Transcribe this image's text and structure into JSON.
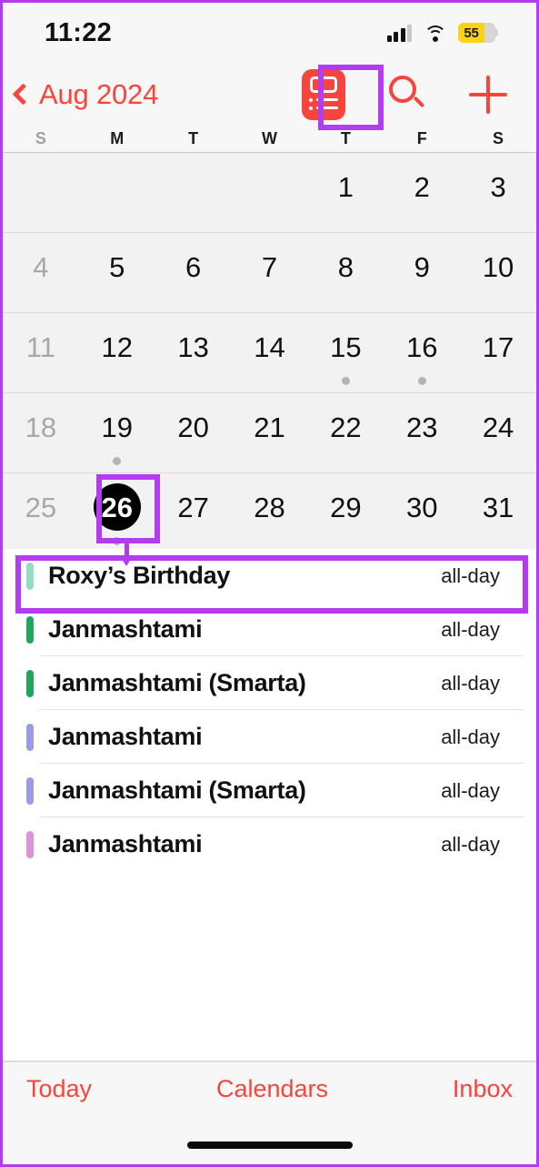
{
  "status_bar": {
    "time": "11:22",
    "battery_percent": "55",
    "signal_icon": "cellular-signal-icon",
    "wifi_icon": "wifi-icon",
    "battery_icon": "battery-icon",
    "battery_color": "#fcd216"
  },
  "nav_bar": {
    "back_label": "Aug 2024",
    "back_icon": "chevron-left-icon",
    "list_view_icon": "list-view-toggle-icon",
    "search_icon": "search-icon",
    "add_icon": "plus-icon",
    "accent_color": "#f5453c"
  },
  "weekdays": [
    {
      "label": "S",
      "dim": true
    },
    {
      "label": "M",
      "dim": false
    },
    {
      "label": "T",
      "dim": false
    },
    {
      "label": "W",
      "dim": false
    },
    {
      "label": "T",
      "dim": false
    },
    {
      "label": "F",
      "dim": false
    },
    {
      "label": "S",
      "dim": false
    }
  ],
  "calendar": {
    "month_label": "Aug 2024",
    "selected_day": "26",
    "rows": [
      [
        {
          "label": "",
          "dim": false,
          "selected": false,
          "dot": false
        },
        {
          "label": "",
          "dim": false,
          "selected": false,
          "dot": false
        },
        {
          "label": "",
          "dim": false,
          "selected": false,
          "dot": false
        },
        {
          "label": "",
          "dim": false,
          "selected": false,
          "dot": false
        },
        {
          "label": "1",
          "dim": false,
          "selected": false,
          "dot": false
        },
        {
          "label": "2",
          "dim": false,
          "selected": false,
          "dot": false
        },
        {
          "label": "3",
          "dim": false,
          "selected": false,
          "dot": false
        }
      ],
      [
        {
          "label": "4",
          "dim": true,
          "selected": false,
          "dot": false
        },
        {
          "label": "5",
          "dim": false,
          "selected": false,
          "dot": false
        },
        {
          "label": "6",
          "dim": false,
          "selected": false,
          "dot": false
        },
        {
          "label": "7",
          "dim": false,
          "selected": false,
          "dot": false
        },
        {
          "label": "8",
          "dim": false,
          "selected": false,
          "dot": false
        },
        {
          "label": "9",
          "dim": false,
          "selected": false,
          "dot": false
        },
        {
          "label": "10",
          "dim": false,
          "selected": false,
          "dot": false
        }
      ],
      [
        {
          "label": "11",
          "dim": true,
          "selected": false,
          "dot": false
        },
        {
          "label": "12",
          "dim": false,
          "selected": false,
          "dot": false
        },
        {
          "label": "13",
          "dim": false,
          "selected": false,
          "dot": false
        },
        {
          "label": "14",
          "dim": false,
          "selected": false,
          "dot": false
        },
        {
          "label": "15",
          "dim": false,
          "selected": false,
          "dot": true
        },
        {
          "label": "16",
          "dim": false,
          "selected": false,
          "dot": true
        },
        {
          "label": "17",
          "dim": false,
          "selected": false,
          "dot": false
        }
      ],
      [
        {
          "label": "18",
          "dim": true,
          "selected": false,
          "dot": false
        },
        {
          "label": "19",
          "dim": false,
          "selected": false,
          "dot": true
        },
        {
          "label": "20",
          "dim": false,
          "selected": false,
          "dot": false
        },
        {
          "label": "21",
          "dim": false,
          "selected": false,
          "dot": false
        },
        {
          "label": "22",
          "dim": false,
          "selected": false,
          "dot": false
        },
        {
          "label": "23",
          "dim": false,
          "selected": false,
          "dot": false
        },
        {
          "label": "24",
          "dim": false,
          "selected": false,
          "dot": false
        }
      ],
      [
        {
          "label": "25",
          "dim": true,
          "selected": false,
          "dot": false
        },
        {
          "label": "26",
          "dim": false,
          "selected": true,
          "dot": true
        },
        {
          "label": "27",
          "dim": false,
          "selected": false,
          "dot": false
        },
        {
          "label": "28",
          "dim": false,
          "selected": false,
          "dot": false
        },
        {
          "label": "29",
          "dim": false,
          "selected": false,
          "dot": false
        },
        {
          "label": "30",
          "dim": false,
          "selected": false,
          "dot": false
        },
        {
          "label": "31",
          "dim": false,
          "selected": false,
          "dot": false
        }
      ]
    ]
  },
  "events": [
    {
      "title": "Roxy’s Birthday",
      "meta": "all-day",
      "color": "#93dcc6"
    },
    {
      "title": "Janmashtami",
      "meta": "all-day",
      "color": "#21a65d"
    },
    {
      "title": "Janmashtami (Smarta)",
      "meta": "all-day",
      "color": "#21a65d"
    },
    {
      "title": "Janmashtami",
      "meta": "all-day",
      "color": "#9a9ae8"
    },
    {
      "title": "Janmashtami (Smarta)",
      "meta": "all-day",
      "color": "#9a9ae8"
    },
    {
      "title": "Janmashtami",
      "meta": "all-day",
      "color": "#dd92dd"
    }
  ],
  "toolbar": {
    "today_label": "Today",
    "calendars_label": "Calendars",
    "inbox_label": "Inbox"
  },
  "annotations": {
    "color": "#b43cf0",
    "highlight_list_view_icon": true,
    "highlight_selected_day": true,
    "highlight_first_event": true
  }
}
